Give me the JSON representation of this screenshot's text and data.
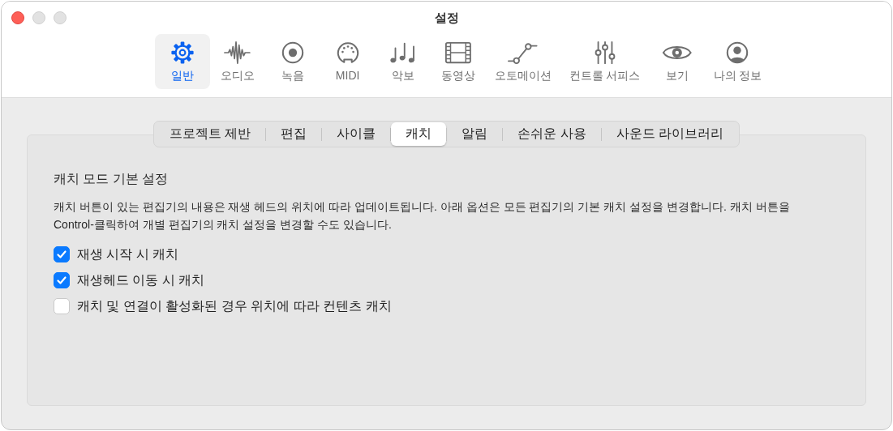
{
  "window": {
    "title": "설정"
  },
  "toolbar": [
    {
      "label": "일반",
      "kind": "gear",
      "selected": true
    },
    {
      "label": "오디오",
      "kind": "waveform",
      "selected": false
    },
    {
      "label": "녹음",
      "kind": "record",
      "selected": false
    },
    {
      "label": "MIDI",
      "kind": "midi",
      "selected": false
    },
    {
      "label": "악보",
      "kind": "notes",
      "selected": false
    },
    {
      "label": "동영상",
      "kind": "film",
      "selected": false
    },
    {
      "label": "오토메이션",
      "kind": "automation",
      "selected": false
    },
    {
      "label": "컨트롤 서피스",
      "kind": "sliders",
      "selected": false
    },
    {
      "label": "보기",
      "kind": "eye",
      "selected": false
    },
    {
      "label": "나의 정보",
      "kind": "person",
      "selected": false
    }
  ],
  "tabs": [
    {
      "label": "프로젝트 제반",
      "selected": false
    },
    {
      "label": "편집",
      "selected": false
    },
    {
      "label": "사이클",
      "selected": false
    },
    {
      "label": "캐치",
      "selected": true
    },
    {
      "label": "알림",
      "selected": false
    },
    {
      "label": "손쉬운 사용",
      "selected": false
    },
    {
      "label": "사운드 라이브러리",
      "selected": false
    }
  ],
  "section": {
    "heading": "캐치 모드 기본 설정",
    "description": "캐치 버튼이 있는 편집기의 내용은 재생 헤드의 위치에 따라 업데이트됩니다. 아래 옵션은 모든 편집기의 기본 캐치 설정을 변경합니다. 캐치 버튼을 Control-클릭하여 개별 편집기의 캐치 설정을 변경할 수도 있습니다.",
    "options": [
      {
        "label": "재생 시작 시 캐치",
        "checked": true
      },
      {
        "label": "재생헤드 이동 시 캐치",
        "checked": true
      },
      {
        "label": "캐치 및 연결이 활성화된 경우 위치에 따라 컨텐츠 캐치",
        "checked": false
      }
    ]
  }
}
